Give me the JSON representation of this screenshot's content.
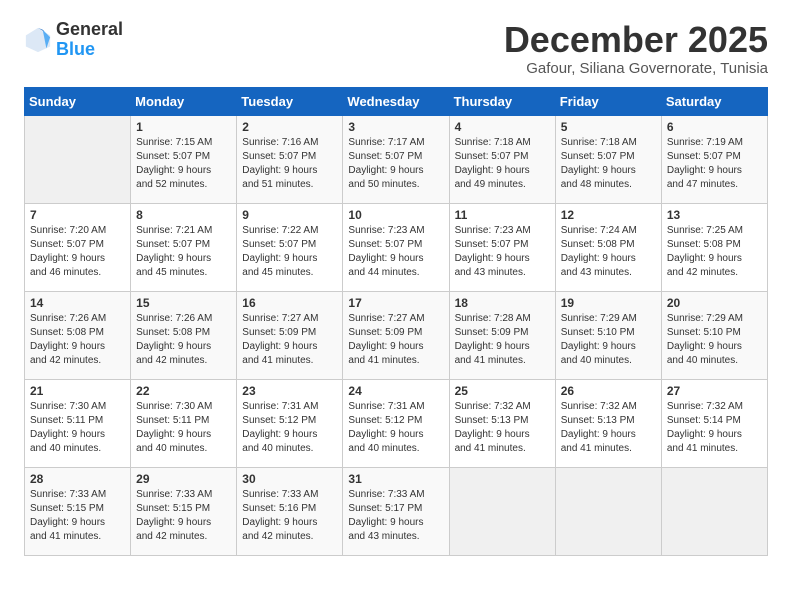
{
  "logo": {
    "general": "General",
    "blue": "Blue"
  },
  "title": "December 2025",
  "subtitle": "Gafour, Siliana Governorate, Tunisia",
  "days_header": [
    "Sunday",
    "Monday",
    "Tuesday",
    "Wednesday",
    "Thursday",
    "Friday",
    "Saturday"
  ],
  "weeks": [
    [
      {
        "day": "",
        "info": ""
      },
      {
        "day": "1",
        "info": "Sunrise: 7:15 AM\nSunset: 5:07 PM\nDaylight: 9 hours\nand 52 minutes."
      },
      {
        "day": "2",
        "info": "Sunrise: 7:16 AM\nSunset: 5:07 PM\nDaylight: 9 hours\nand 51 minutes."
      },
      {
        "day": "3",
        "info": "Sunrise: 7:17 AM\nSunset: 5:07 PM\nDaylight: 9 hours\nand 50 minutes."
      },
      {
        "day": "4",
        "info": "Sunrise: 7:18 AM\nSunset: 5:07 PM\nDaylight: 9 hours\nand 49 minutes."
      },
      {
        "day": "5",
        "info": "Sunrise: 7:18 AM\nSunset: 5:07 PM\nDaylight: 9 hours\nand 48 minutes."
      },
      {
        "day": "6",
        "info": "Sunrise: 7:19 AM\nSunset: 5:07 PM\nDaylight: 9 hours\nand 47 minutes."
      }
    ],
    [
      {
        "day": "7",
        "info": "Sunrise: 7:20 AM\nSunset: 5:07 PM\nDaylight: 9 hours\nand 46 minutes."
      },
      {
        "day": "8",
        "info": "Sunrise: 7:21 AM\nSunset: 5:07 PM\nDaylight: 9 hours\nand 45 minutes."
      },
      {
        "day": "9",
        "info": "Sunrise: 7:22 AM\nSunset: 5:07 PM\nDaylight: 9 hours\nand 45 minutes."
      },
      {
        "day": "10",
        "info": "Sunrise: 7:23 AM\nSunset: 5:07 PM\nDaylight: 9 hours\nand 44 minutes."
      },
      {
        "day": "11",
        "info": "Sunrise: 7:23 AM\nSunset: 5:07 PM\nDaylight: 9 hours\nand 43 minutes."
      },
      {
        "day": "12",
        "info": "Sunrise: 7:24 AM\nSunset: 5:08 PM\nDaylight: 9 hours\nand 43 minutes."
      },
      {
        "day": "13",
        "info": "Sunrise: 7:25 AM\nSunset: 5:08 PM\nDaylight: 9 hours\nand 42 minutes."
      }
    ],
    [
      {
        "day": "14",
        "info": "Sunrise: 7:26 AM\nSunset: 5:08 PM\nDaylight: 9 hours\nand 42 minutes."
      },
      {
        "day": "15",
        "info": "Sunrise: 7:26 AM\nSunset: 5:08 PM\nDaylight: 9 hours\nand 42 minutes."
      },
      {
        "day": "16",
        "info": "Sunrise: 7:27 AM\nSunset: 5:09 PM\nDaylight: 9 hours\nand 41 minutes."
      },
      {
        "day": "17",
        "info": "Sunrise: 7:27 AM\nSunset: 5:09 PM\nDaylight: 9 hours\nand 41 minutes."
      },
      {
        "day": "18",
        "info": "Sunrise: 7:28 AM\nSunset: 5:09 PM\nDaylight: 9 hours\nand 41 minutes."
      },
      {
        "day": "19",
        "info": "Sunrise: 7:29 AM\nSunset: 5:10 PM\nDaylight: 9 hours\nand 40 minutes."
      },
      {
        "day": "20",
        "info": "Sunrise: 7:29 AM\nSunset: 5:10 PM\nDaylight: 9 hours\nand 40 minutes."
      }
    ],
    [
      {
        "day": "21",
        "info": "Sunrise: 7:30 AM\nSunset: 5:11 PM\nDaylight: 9 hours\nand 40 minutes."
      },
      {
        "day": "22",
        "info": "Sunrise: 7:30 AM\nSunset: 5:11 PM\nDaylight: 9 hours\nand 40 minutes."
      },
      {
        "day": "23",
        "info": "Sunrise: 7:31 AM\nSunset: 5:12 PM\nDaylight: 9 hours\nand 40 minutes."
      },
      {
        "day": "24",
        "info": "Sunrise: 7:31 AM\nSunset: 5:12 PM\nDaylight: 9 hours\nand 40 minutes."
      },
      {
        "day": "25",
        "info": "Sunrise: 7:32 AM\nSunset: 5:13 PM\nDaylight: 9 hours\nand 41 minutes."
      },
      {
        "day": "26",
        "info": "Sunrise: 7:32 AM\nSunset: 5:13 PM\nDaylight: 9 hours\nand 41 minutes."
      },
      {
        "day": "27",
        "info": "Sunrise: 7:32 AM\nSunset: 5:14 PM\nDaylight: 9 hours\nand 41 minutes."
      }
    ],
    [
      {
        "day": "28",
        "info": "Sunrise: 7:33 AM\nSunset: 5:15 PM\nDaylight: 9 hours\nand 41 minutes."
      },
      {
        "day": "29",
        "info": "Sunrise: 7:33 AM\nSunset: 5:15 PM\nDaylight: 9 hours\nand 42 minutes."
      },
      {
        "day": "30",
        "info": "Sunrise: 7:33 AM\nSunset: 5:16 PM\nDaylight: 9 hours\nand 42 minutes."
      },
      {
        "day": "31",
        "info": "Sunrise: 7:33 AM\nSunset: 5:17 PM\nDaylight: 9 hours\nand 43 minutes."
      },
      {
        "day": "",
        "info": ""
      },
      {
        "day": "",
        "info": ""
      },
      {
        "day": "",
        "info": ""
      }
    ]
  ]
}
